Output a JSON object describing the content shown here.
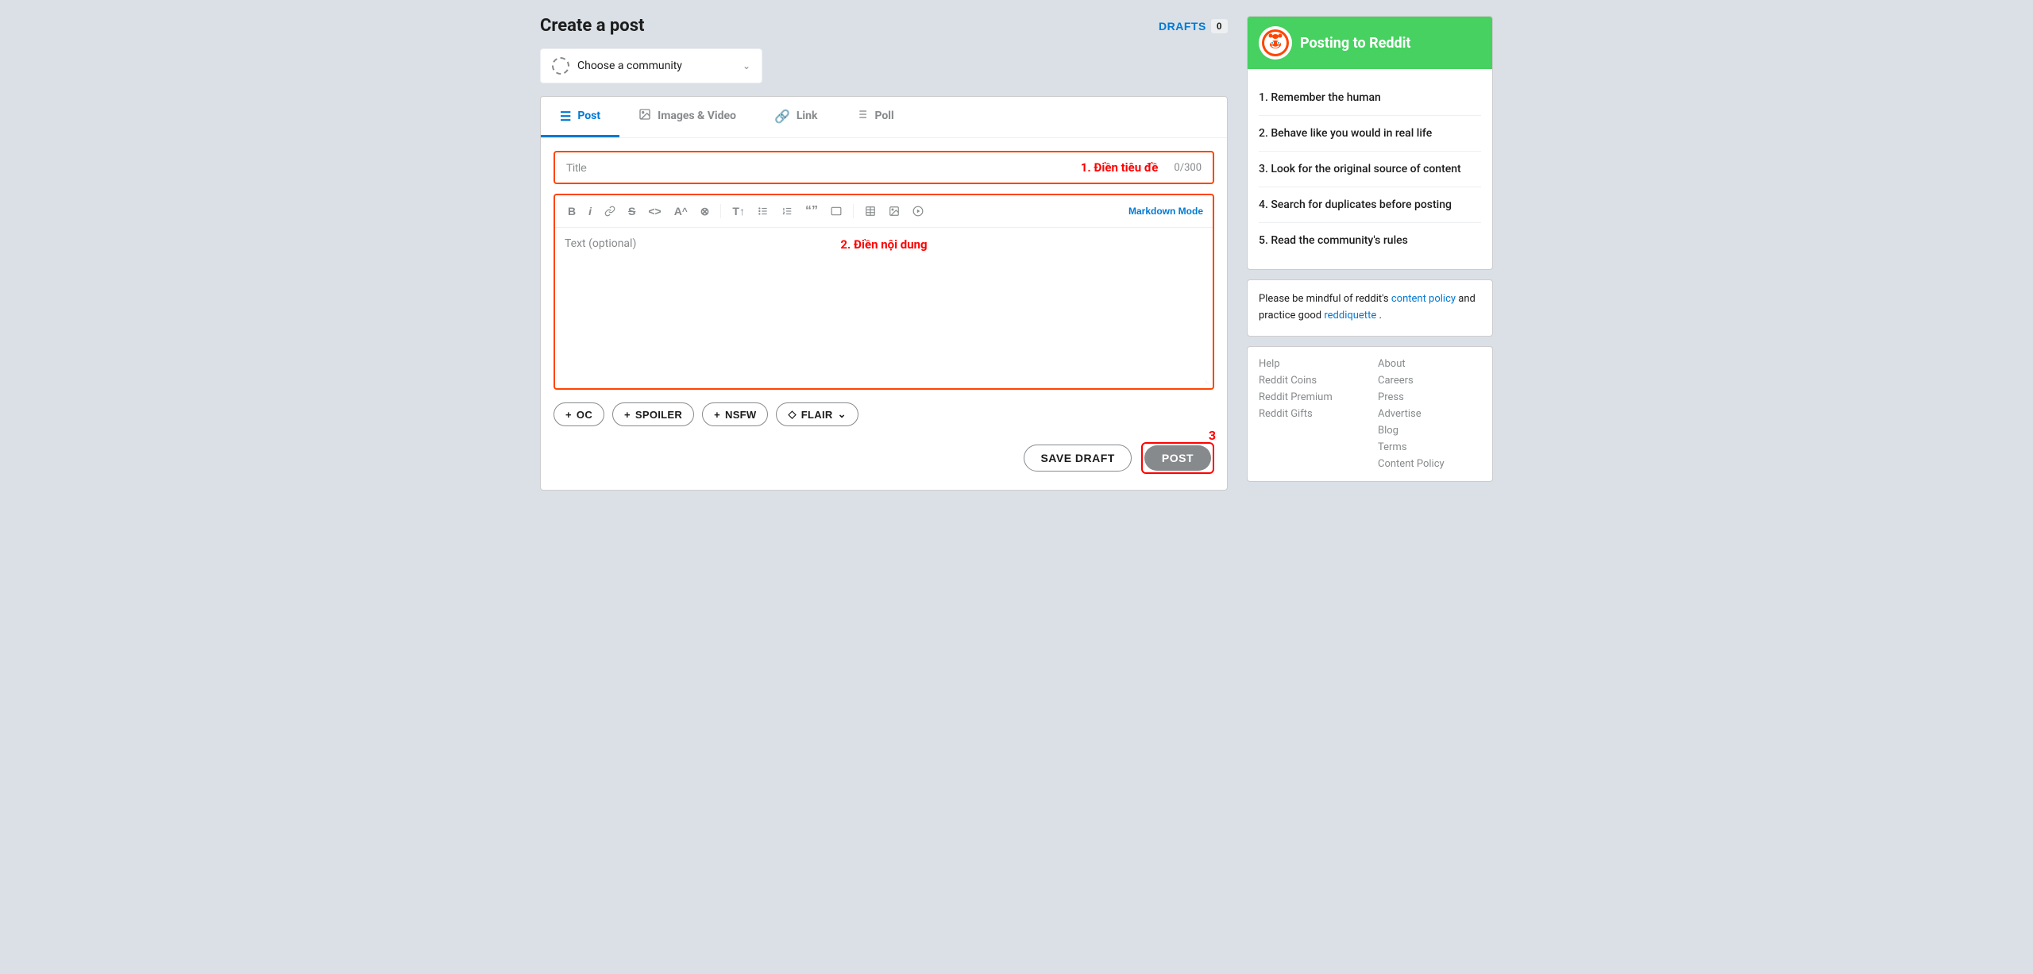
{
  "header": {
    "title": "Create a post",
    "drafts_label": "DRAFTS",
    "drafts_count": "0"
  },
  "community_selector": {
    "placeholder": "Choose a community",
    "chevron": "∨"
  },
  "tabs": [
    {
      "id": "post",
      "label": "Post",
      "icon": "≡",
      "active": true
    },
    {
      "id": "images-video",
      "label": "Images & Video",
      "icon": "🖼",
      "active": false
    },
    {
      "id": "link",
      "label": "Link",
      "icon": "🔗",
      "active": false
    },
    {
      "id": "poll",
      "label": "Poll",
      "icon": "≔",
      "active": false
    }
  ],
  "title_field": {
    "placeholder": "Title",
    "hint": "1. Điền tiêu đề",
    "count": "0/300"
  },
  "editor": {
    "toolbar": {
      "bold": "B",
      "italic": "i",
      "link": "🔗",
      "strikethrough": "S̶",
      "code_inline": "<>",
      "superscript": "A^",
      "spoiler": "⊕",
      "heading": "T↑",
      "bullet_list": "≡",
      "numbered_list": "≡#",
      "blockquote": "❝❝",
      "code_block": "□",
      "table": "⊞",
      "image": "🖼",
      "video": "▶",
      "markdown_mode": "Markdown Mode"
    },
    "placeholder": "Text (optional)",
    "hint": "2. Điền nội dung"
  },
  "extra_buttons": [
    {
      "label": "OC",
      "icon": "+"
    },
    {
      "label": "SPOILER",
      "icon": "+"
    },
    {
      "label": "NSFW",
      "icon": "+"
    },
    {
      "label": "FLAIR ∨",
      "icon": "◇"
    }
  ],
  "actions": {
    "save_draft": "SAVE DRAFT",
    "post": "POST",
    "number_badge": "3"
  },
  "sidebar": {
    "posting_to_reddit": {
      "title": "Posting to Reddit",
      "rules": [
        "1. Remember the human",
        "2. Behave like you would in real life",
        "3. Look for the original source of content",
        "4. Search for duplicates before posting",
        "5. Read the community's rules"
      ]
    },
    "mindful_text": "Please be mindful of reddit's ",
    "content_policy_link": "content policy",
    "and_text": " and practice good ",
    "reddiquette_link": "reddiquette",
    "period": ".",
    "footer_links": [
      [
        "Help",
        "About"
      ],
      [
        "Reddit Coins",
        "Careers"
      ],
      [
        "Reddit Premium",
        "Press"
      ],
      [
        "Reddit Gifts",
        "Advertise"
      ],
      [
        "",
        "Blog"
      ],
      [
        "",
        "Terms"
      ],
      [
        "",
        "Content Policy"
      ]
    ]
  }
}
